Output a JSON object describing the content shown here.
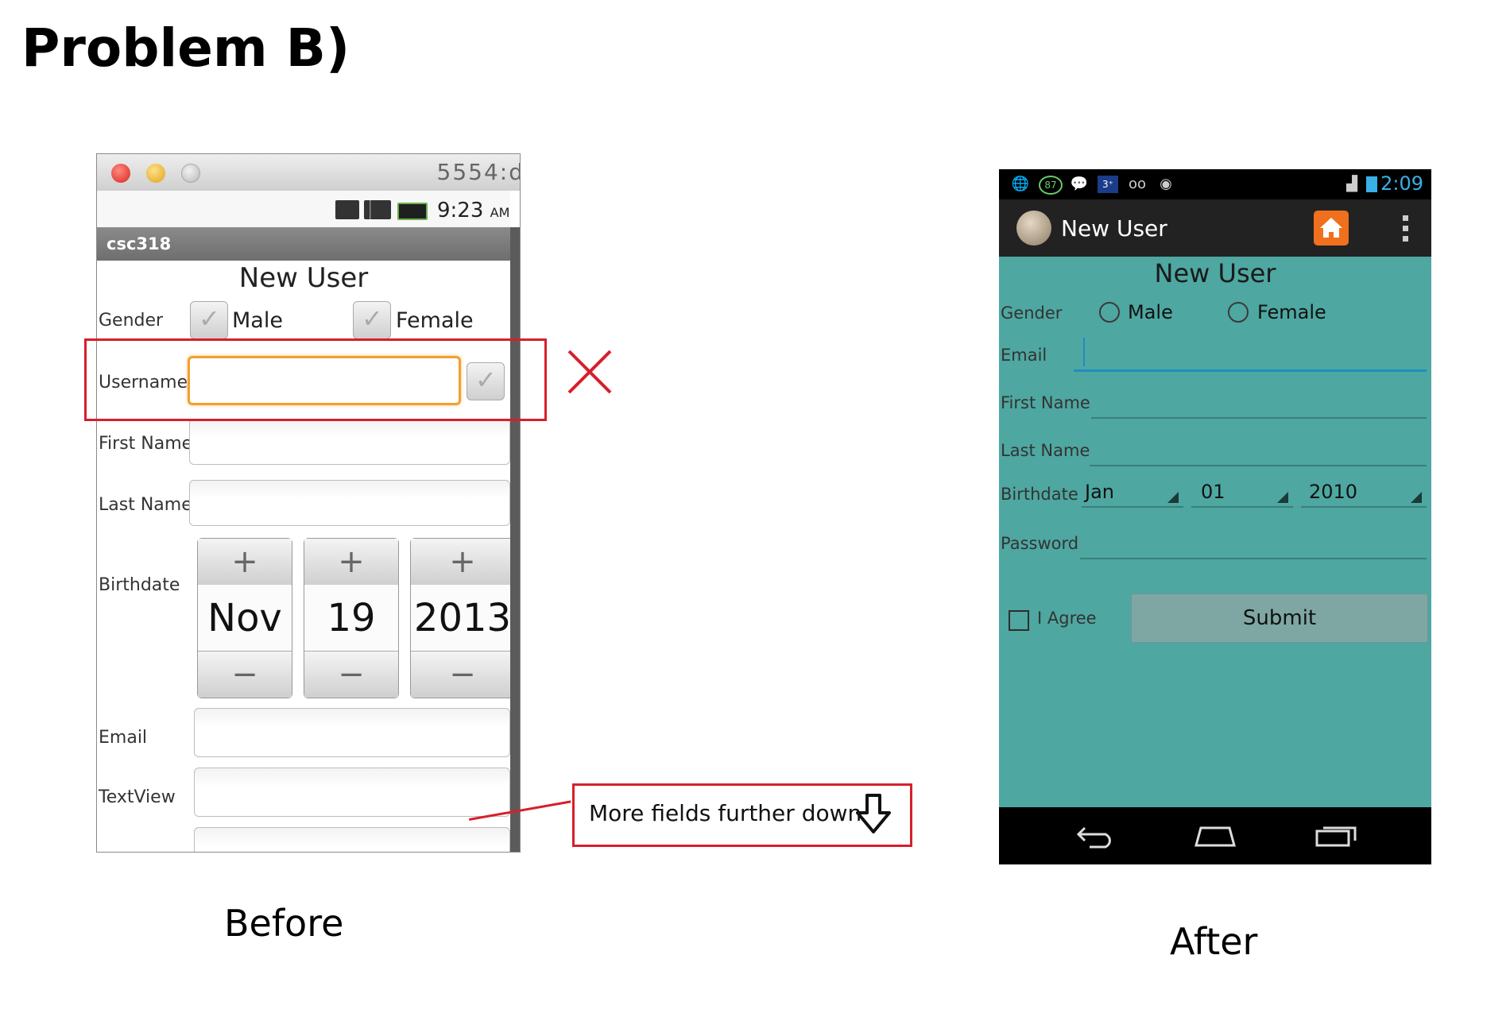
{
  "title": "Problem B)",
  "captions": {
    "before": "Before",
    "after": "After"
  },
  "before": {
    "window_port": "5554:d",
    "status_time": "9:23",
    "status_ampm": "AM",
    "app_name": "csc318",
    "heading": "New User",
    "gender_label": "Gender",
    "male_label": "Male",
    "female_label": "Female",
    "username_label": "Username",
    "first_name_label": "First Name",
    "last_name_label": "Last Name",
    "birthdate_label": "Birthdate",
    "birthdate": {
      "month": "Nov",
      "day": "19",
      "year": "2013",
      "plus": "+",
      "minus": "−"
    },
    "email_label": "Email",
    "textview_label": "TextView"
  },
  "annotation": {
    "note": "More fields further down",
    "accent_color": "#d71f2b"
  },
  "after": {
    "status_time": "2:09",
    "battery_text": "87",
    "actionbar_title": "New User",
    "heading": "New User",
    "gender_label": "Gender",
    "male_label": "Male",
    "female_label": "Female",
    "email_label": "Email",
    "first_name_label": "First Name",
    "last_name_label": "Last Name",
    "birthdate_label": "Birthdate",
    "birthdate": {
      "month": "Jan",
      "day": "01",
      "year": "2010"
    },
    "password_label": "Password",
    "agree_label": "I Agree",
    "submit_label": "Submit",
    "background_color": "#4ea7a1"
  }
}
